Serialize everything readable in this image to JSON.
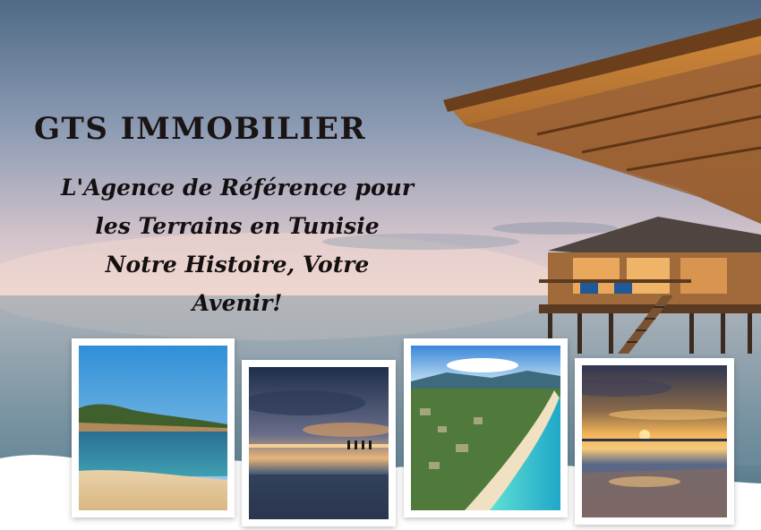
{
  "brand": {
    "name": "GTS IMMOBILIER"
  },
  "tagline": {
    "line1": "L'Agence de Référence pour",
    "line2": "les Terrains en Tunisie",
    "line3": "Notre Histoire, Votre",
    "line4": "Avenir!"
  },
  "photos": [
    {
      "subject": "rocky coastline with turquoise sea and sandy beach"
    },
    {
      "subject": "dramatic sunset over the sea with pier posts"
    },
    {
      "subject": "aerial view of turquoise beach and coastal town with mountains"
    },
    {
      "subject": "golden sunset reflected on wet sand"
    }
  ],
  "colors": {
    "text": "#1a1414",
    "frame": "#ffffff",
    "sea": "#5c8ea6"
  }
}
